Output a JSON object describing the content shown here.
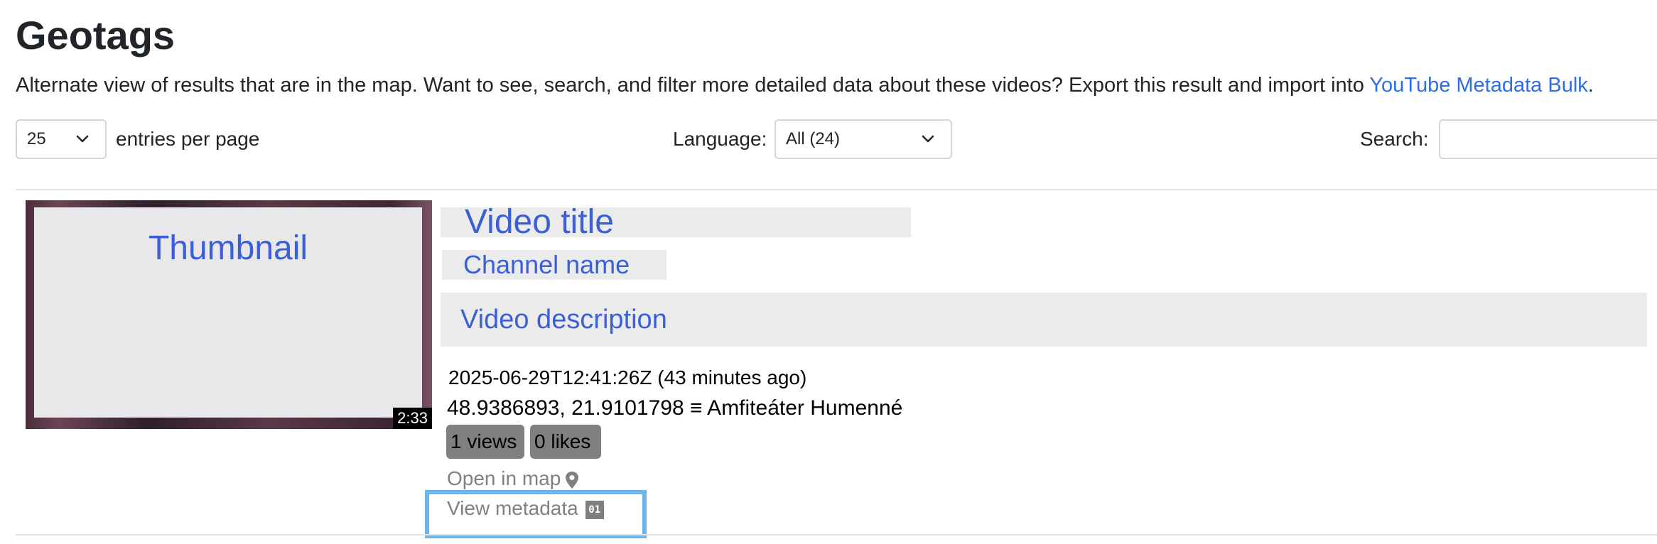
{
  "page": {
    "title": "Geotags",
    "intro_text": "Alternate view of results that are in the map. Want to see, search, and filter more detailed data about these videos? Export this result and import into ",
    "intro_link": "YouTube Metadata Bulk",
    "intro_end": "."
  },
  "controls": {
    "entries_value": "25",
    "entries_label": "entries per page",
    "language_label": "Language:",
    "language_value": "All (24)",
    "search_label": "Search:",
    "search_value": ""
  },
  "result": {
    "thumbnail_label": "Thumbnail",
    "duration": "2:33",
    "video_title": "Video title",
    "channel_name": "Channel name",
    "description": "Video description",
    "published": "2025-06-29T12:41:26Z (43 minutes ago)",
    "location": "48.9386893, 21.9101798 ≡ Amfiteáter Humenné",
    "views": "1 views",
    "likes": "0 likes",
    "open_map_label": "Open in map",
    "view_metadata_label": "View metadata",
    "metadata_icon_text": "01"
  },
  "icons": {
    "pin": "map-pin-icon",
    "metadata": "metadata-icon",
    "chevron": "chevron-down-icon"
  },
  "colors": {
    "link": "#2d6ee6",
    "placeholder_text": "#3a5fd8",
    "badge": "#808080",
    "highlight": "#6cb5ea"
  }
}
